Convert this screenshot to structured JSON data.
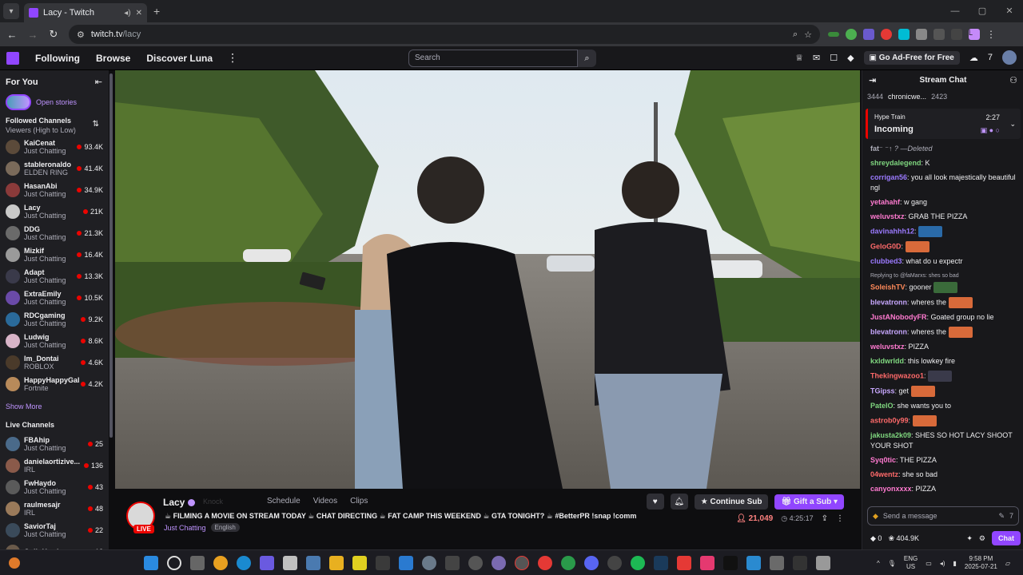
{
  "browser": {
    "tab_title": "Lacy - Twitch",
    "url_host": "twitch.tv",
    "url_path": "/lacy"
  },
  "topnav": {
    "following": "Following",
    "browse": "Browse",
    "discover": "Discover Luna",
    "search_placeholder": "Search",
    "adfree": "Go Ad-Free for Free"
  },
  "sidebar": {
    "for_you": "For You",
    "open_stories": "Open stories",
    "followed_header": "Followed Channels",
    "followed_sort": "Viewers (High to Low)",
    "followed": [
      {
        "name": "KaiCenat",
        "game": "Just Chatting",
        "viewers": "93.4K",
        "color": "#5b4a3a"
      },
      {
        "name": "stableronaldo",
        "game": "ELDEN RING",
        "viewers": "41.4K",
        "color": "#7a6a5a"
      },
      {
        "name": "HasanAbi",
        "game": "Just Chatting",
        "viewers": "34.9K",
        "color": "#8a3a3a"
      },
      {
        "name": "Lacy",
        "game": "Just Chatting",
        "viewers": "21K",
        "color": "#c9c9c9"
      },
      {
        "name": "DDG",
        "game": "Just Chatting",
        "viewers": "21.3K",
        "color": "#6a6a6a"
      },
      {
        "name": "Mizkif",
        "game": "Just Chatting",
        "viewers": "16.4K",
        "color": "#9a9a9a"
      },
      {
        "name": "Adapt",
        "game": "Just Chatting",
        "viewers": "13.3K",
        "color": "#3a3a4a"
      },
      {
        "name": "ExtraEmily",
        "game": "Just Chatting",
        "viewers": "10.5K",
        "color": "#6a4aa8"
      },
      {
        "name": "RDCgaming",
        "game": "Just Chatting",
        "viewers": "9.2K",
        "color": "#2a6a9a"
      },
      {
        "name": "Ludwig",
        "game": "Just Chatting",
        "viewers": "8.6K",
        "color": "#d8b4c8"
      },
      {
        "name": "Im_Dontai",
        "game": "ROBLOX",
        "viewers": "4.6K",
        "color": "#4a3a2a"
      },
      {
        "name": "HappyHappyGal",
        "game": "Fortnite",
        "viewers": "4.2K",
        "color": "#b88a5a"
      }
    ],
    "show_more": "Show More",
    "live_header": "Live Channels",
    "live": [
      {
        "name": "FBAhip",
        "game": "Just Chatting",
        "viewers": "25",
        "color": "#4a6a8a"
      },
      {
        "name": "danielaortizive...",
        "game": "IRL",
        "viewers": "136",
        "color": "#8a5a4a"
      },
      {
        "name": "FwHaydo",
        "game": "Just Chatting",
        "viewers": "43",
        "color": "#5a5a5a"
      },
      {
        "name": "raulmesajr",
        "game": "IRL",
        "viewers": "48",
        "color": "#9a7a5a"
      },
      {
        "name": "SaviorTaj",
        "game": "Just Chatting",
        "viewers": "22",
        "color": "#3a4a5a"
      },
      {
        "name": "ColinHarris",
        "game": "",
        "viewers": "12",
        "color": "#6a5a4a"
      }
    ]
  },
  "stream": {
    "streamer": "Lacy",
    "knock": "Knock",
    "tabs": [
      "Schedule",
      "Videos",
      "Clips"
    ],
    "title": "☕ FILMING A MOVIE ON STREAM TODAY ☕ CHAT DIRECTING ☕ FAT CAMP THIS WEEKEND ☕ GTA TONIGHT? ☕ #BetterPR !snap !comm",
    "category": "Just Chatting",
    "tag": "English",
    "live": "LIVE",
    "continue_sub": "Continue Sub",
    "gift_sub": "Gift a Sub",
    "viewers": "21,049",
    "uptime": "4:25:17"
  },
  "chat": {
    "title": "Stream Chat",
    "leader_1": "3444",
    "leader_name": "chronicwe...",
    "leader_2": "2423",
    "hype_label": "Hype Train",
    "hype_status": "Incoming",
    "hype_time": "2:27",
    "messages": [
      {
        "user": "fat",
        "text": "⁻ ⁻↑ ? —Deleted",
        "color": "#adadb8",
        "deleted": true
      },
      {
        "user": "shreydalegend",
        "text": ": K",
        "color": "#7fd67f"
      },
      {
        "user": "corrigan56",
        "text": ": you all look majestically beautiful ngl",
        "color": "#9b7aff"
      },
      {
        "user": "yetahahf",
        "text": ": w gang",
        "color": "#ff7ad0"
      },
      {
        "user": "weluvstxz",
        "text": ": GRAB THE PIZZA",
        "color": "#ff7ad0"
      },
      {
        "user": "davinahhh12",
        "text": ":",
        "color": "#9b7aff",
        "emote": "#2a6aa8"
      },
      {
        "user": "GeloG0D",
        "text": ":",
        "color": "#ff6a6a",
        "emote": "#d86a3a"
      },
      {
        "user": "clubbed3",
        "text": ": what do u expectr",
        "color": "#9b7aff"
      },
      {
        "reply": "Replying to @faMarxs: shes so bad"
      },
      {
        "user": "SoleishTV",
        "text": ": gooner",
        "color": "#ff8a5a",
        "emote": "#3a6a3a"
      },
      {
        "user": "blevatronn",
        "text": ": wheres the",
        "color": "#c8a8ff",
        "emote": "#d86a3a"
      },
      {
        "user": "JustANobodyFR",
        "text": ": Goated group no lie",
        "color": "#ff7ad0"
      },
      {
        "user": "blevatronn",
        "text": ": wheres the",
        "color": "#c8a8ff",
        "emote": "#d86a3a"
      },
      {
        "user": "weluvstxz",
        "text": ": PIZZA",
        "color": "#ff7ad0"
      },
      {
        "user": "kxldwrldd",
        "text": ": this lowkey fire",
        "color": "#7fd67f"
      },
      {
        "user": "Thekingwazoo1",
        "text": ":",
        "color": "#ff6a6a",
        "emote": "#3a3a4a"
      },
      {
        "user": "TGipss",
        "text": ": get",
        "color": "#c8a8ff",
        "emote": "#d86a3a"
      },
      {
        "user": "PatelO",
        "text": ": she wants you to",
        "color": "#7fd67f"
      },
      {
        "user": "astrob0y99",
        "text": ":",
        "color": "#ff6a6a",
        "emote": "#d86a3a"
      },
      {
        "user": "jakusta2k09",
        "text": ": SHES SO HOT LACY SHOOT YOUR SHOT",
        "color": "#7fd67f"
      },
      {
        "user": "Syq0tic",
        "text": ": THE PIZZA",
        "color": "#ff7ad0"
      },
      {
        "user": "04wentz",
        "text": ": she so bad",
        "color": "#ff6a6a"
      },
      {
        "user": "canyonxxxx",
        "text": ": PIZZA",
        "color": "#ff7ad0"
      }
    ],
    "input_placeholder": "Send a message",
    "points_a": "0",
    "points_b": "404.9K",
    "chat_button": "Chat"
  },
  "taskbar": {
    "lang_1": "ENG",
    "lang_2": "US",
    "time": "9:58 PM",
    "date": "2025-07-21"
  },
  "colors": {
    "twitch_purple": "#9146ff",
    "live_red": "#eb0400"
  }
}
